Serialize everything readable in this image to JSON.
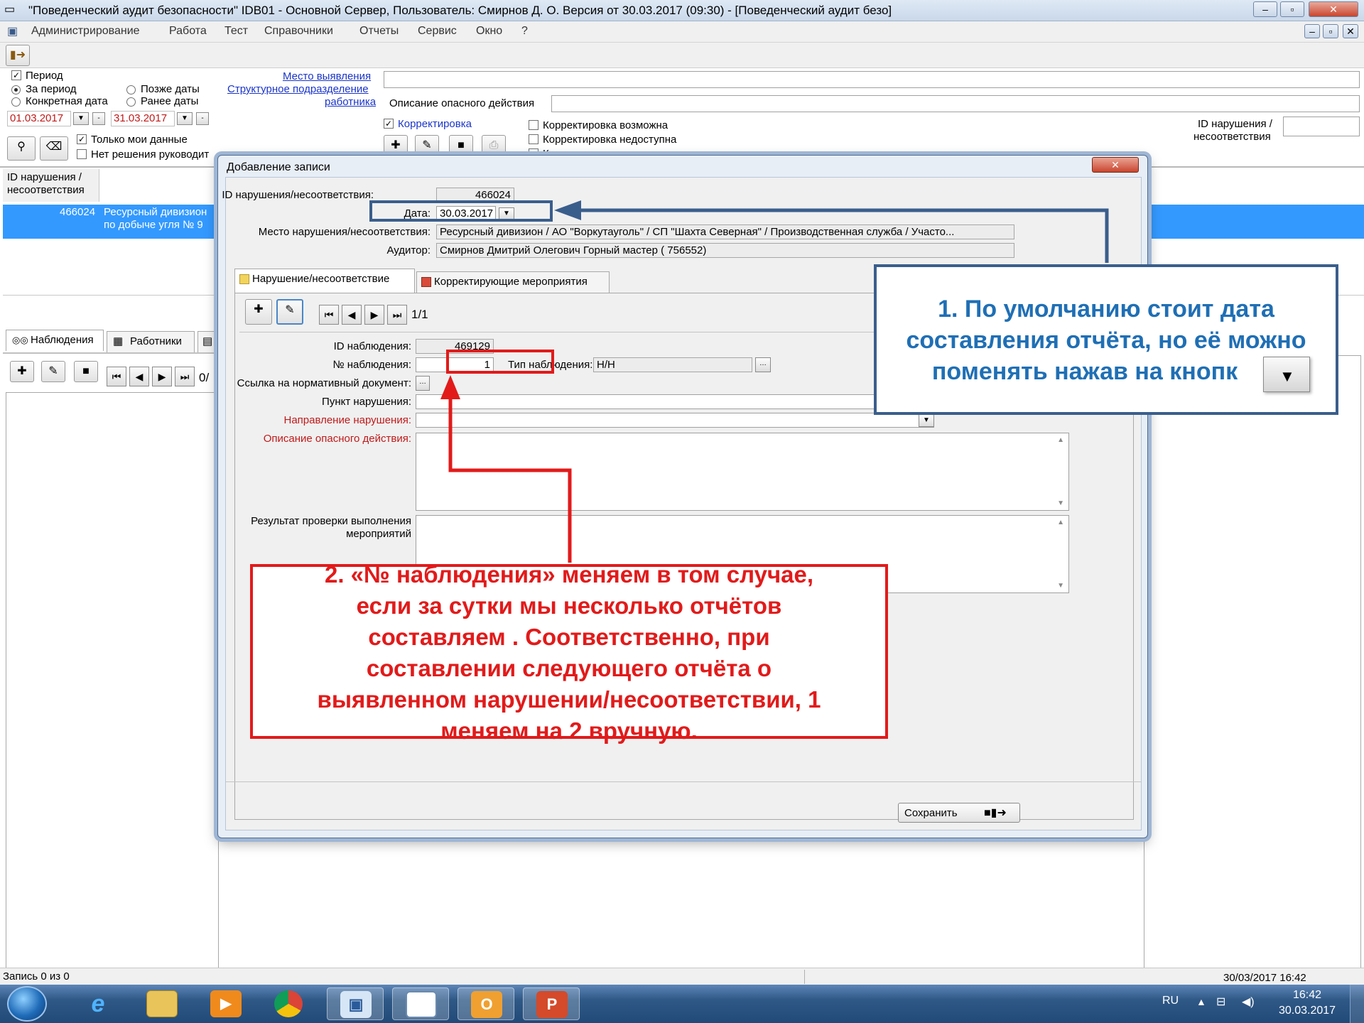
{
  "window": {
    "title": "\"Поведенческий аудит безопасности\"   IDB01 - Основной Сервер,    Пользователь: Смирнов Д. О.    Версия от 30.03.2017 (09:30) - [Поведенческий аудит безо]",
    "minimize": "–",
    "restore": "▫",
    "close": "✕"
  },
  "menu": [
    "Администрирование",
    "Работа",
    "Тест",
    "Справочники",
    "Отчеты",
    "Сервис",
    "Окно",
    "?"
  ],
  "filter": {
    "period_label": "Период",
    "radio_period": "За период",
    "radio_specific": "Конкретная дата",
    "radio_after": "Позже даты",
    "radio_before": "Ранее даты",
    "date_from": "01.03.2017",
    "date_to": "31.03.2017",
    "only_mine": "Только мои данные",
    "no_decision": "Нет решения руководит",
    "link_place": "Место выявления",
    "link_unit": "Структурное подразделение",
    "link_worker": "работника",
    "danger_desc_label": "Описание опасного действия",
    "correction_label": "Корректировка",
    "corr_possible": "Корректировка возможна",
    "corr_unavailable": "Корректировка недоступна",
    "corr_forbidden": "Корректировка запрещена - данные выгружены в реестр",
    "id_label_line1": "ID нарушения /",
    "id_label_line2": "несоответствия"
  },
  "grid": {
    "header_line1": "ID нарушения /",
    "header_line2": "несоответствия",
    "row_id": "466024",
    "row_text_line1": "Ресурсный дивизион",
    "row_text_line2": "по добыче угля № 9"
  },
  "bottom_tabs": {
    "observations": "Наблюдения",
    "workers": "Работники"
  },
  "bottom_nav_counter": "0/",
  "status": {
    "record": "Запись  0  из  0",
    "datetime": "30/03/2017 16:42"
  },
  "dialog": {
    "title": "Добавление записи",
    "id_label": "ID нарушения/несоответствия:",
    "id_value": "466024",
    "date_label": "Дата:",
    "date_value": "30.03.2017",
    "place_label": "Место нарушения/несоответствия:",
    "place_value": "Ресурсный дивизион / АО \"Воркутауголь\" / СП \"Шахта Северная\" / Производственная служба / Участо...",
    "auditor_label": "Аудитор:",
    "auditor_value": "Смирнов Дмитрий Олегович Горный мастер ( 756552)",
    "tab_violation": "Нарушение/несоответствие",
    "tab_corrective": "Корректирующие мероприятия",
    "nav_counter": "1/1",
    "obs_id_label": "ID наблюдения:",
    "obs_id_value": "469129",
    "obs_num_label": "№ наблюдения:",
    "obs_num_value": "1",
    "obs_type_label": "Тип наблюдения:",
    "obs_type_value": "Н/Н",
    "norm_doc_label": "Ссылка на нормативный документ:",
    "item_label": "Пункт нарушения:",
    "direction_label": "Направление нарушения:",
    "danger_desc_label": "Описание опасного действия:",
    "result_label_line1": "Результат проверки выполнения",
    "result_label_line2": "мероприятий",
    "save_label": "Сохранить"
  },
  "annotations": {
    "callout1": [
      "1. По умолчанию стоит дата",
      "составления отчёта, но её можно",
      "поменять нажав на кнопк"
    ],
    "callout2": [
      "2. «№ наблюдения» меняем в том случае,",
      "если за сутки мы несколько отчётов",
      "составляем . Соответственно, при",
      "составлении следующего отчёта о",
      "выявленном нарушении/несоответствии, 1",
      "меняем на 2 вручную."
    ]
  },
  "taskbar": {
    "lang": "RU",
    "time": "16:42",
    "date": "30.03.2017",
    "icons": [
      "start-orb-icon",
      "internet-explorer-icon",
      "file-explorer-icon",
      "media-player-icon",
      "chrome-icon",
      "app-window-icon",
      "blank-window-icon",
      "outlook-icon",
      "powerpoint-icon"
    ]
  },
  "colors": {
    "selection": "#3399ff",
    "callout_blue": "#1f6fb5",
    "callout_red": "#e21a1a",
    "frame_blue": "#3a5e8c"
  }
}
